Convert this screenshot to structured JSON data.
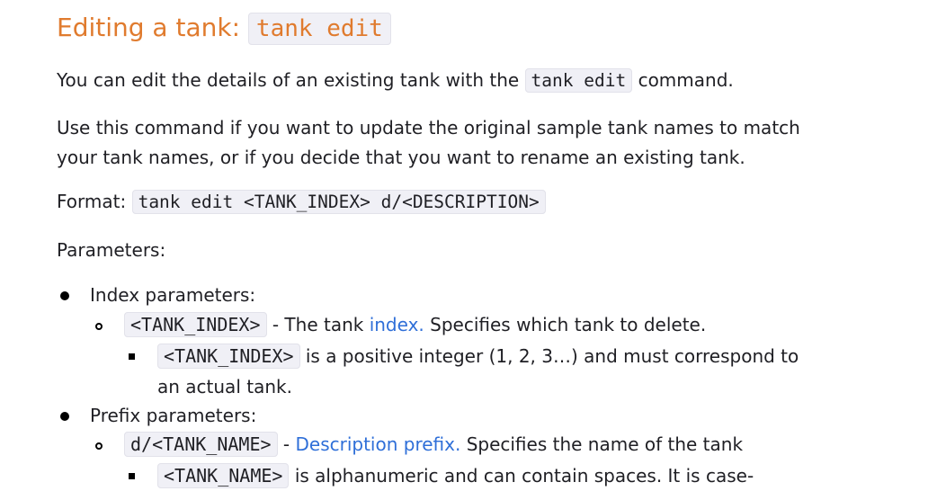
{
  "heading": {
    "prefix": "Editing a tank:",
    "code": "tank edit"
  },
  "intro": {
    "text_before": "You can edit the details of an existing tank with the",
    "code": "tank edit",
    "text_after": "command."
  },
  "usage": {
    "line1": "Use this command if you want to update the original sample tank names to match",
    "line2": "your tank names, or if you decide that you want to rename an existing tank."
  },
  "format": {
    "label": "Format:",
    "code": "tank edit <TANK_INDEX> d/<DESCRIPTION>"
  },
  "parameters_label": "Parameters:",
  "params": {
    "index": {
      "title": "Index parameters:",
      "code": "<TANK_INDEX>",
      "dash": "- The tank",
      "link": "index.",
      "desc": "Specifies which tank to delete.",
      "sub_code": "<TANK_INDEX>",
      "sub_text1": "is a positive integer (1, 2, 3…) and must correspond to",
      "sub_text2": "an actual tank."
    },
    "prefix": {
      "title": "Prefix parameters:",
      "code": "d/<TANK_NAME>",
      "dash": "-",
      "link": "Description prefix.",
      "desc": "Specifies the name of the tank",
      "sub_code": "<TANK_NAME>",
      "sub_text1": "is alphanumeric and can contain spaces. It is case-"
    }
  }
}
